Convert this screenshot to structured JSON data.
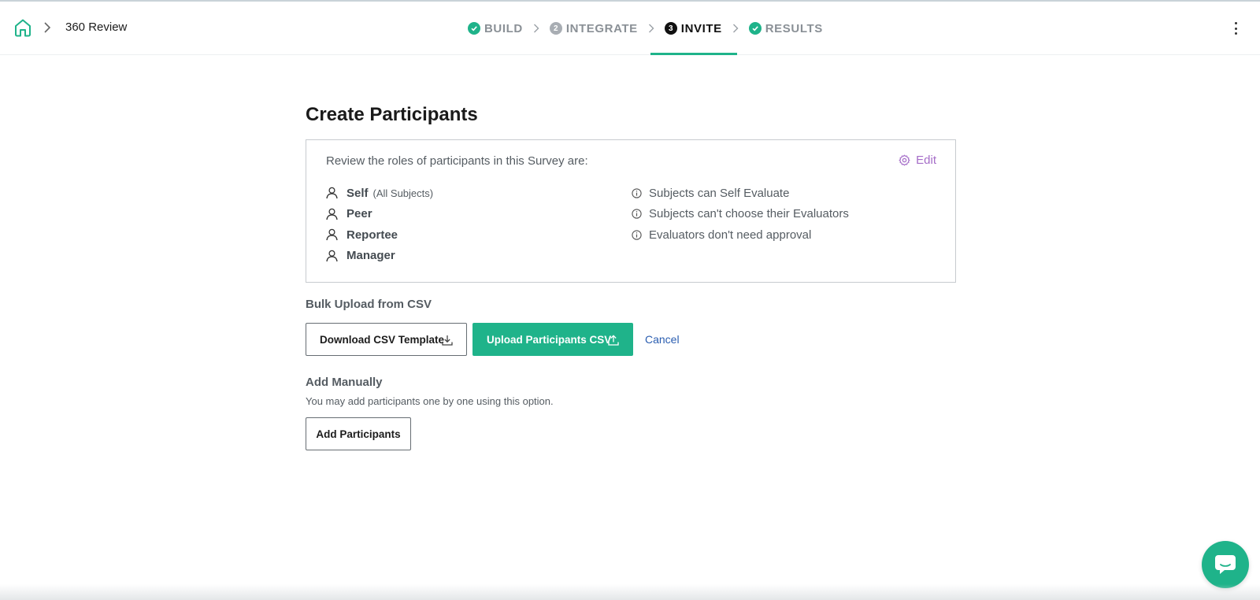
{
  "breadcrumb": {
    "title": "360 Review"
  },
  "steps": [
    {
      "label": "BUILD",
      "state": "done",
      "badge": ""
    },
    {
      "label": "INTEGRATE",
      "state": "pending",
      "badge": "2"
    },
    {
      "label": "INVITE",
      "state": "active",
      "badge": "3"
    },
    {
      "label": "RESULTS",
      "state": "done",
      "badge": ""
    }
  ],
  "page": {
    "title": "Create Participants"
  },
  "roles_box": {
    "intro": "Review the roles of participants in this Survey are:",
    "edit_label": "Edit",
    "roles": [
      {
        "name": "Self",
        "note": "(All Subjects)"
      },
      {
        "name": "Peer",
        "note": ""
      },
      {
        "name": "Reportee",
        "note": ""
      },
      {
        "name": "Manager",
        "note": ""
      }
    ],
    "rules": [
      "Subjects can Self Evaluate",
      "Subjects can't choose their Evaluators",
      "Evaluators don't need approval"
    ]
  },
  "bulk": {
    "heading": "Bulk Upload from CSV",
    "download_label": "Download CSV Template",
    "upload_label": "Upload Participants CSV",
    "cancel_label": "Cancel"
  },
  "manual": {
    "heading": "Add Manually",
    "description": "You may add participants one by one using this option.",
    "add_label": "Add Participants"
  },
  "colors": {
    "accent": "#1fb38a",
    "edit": "#a56dc8",
    "link": "#2a5db0"
  }
}
